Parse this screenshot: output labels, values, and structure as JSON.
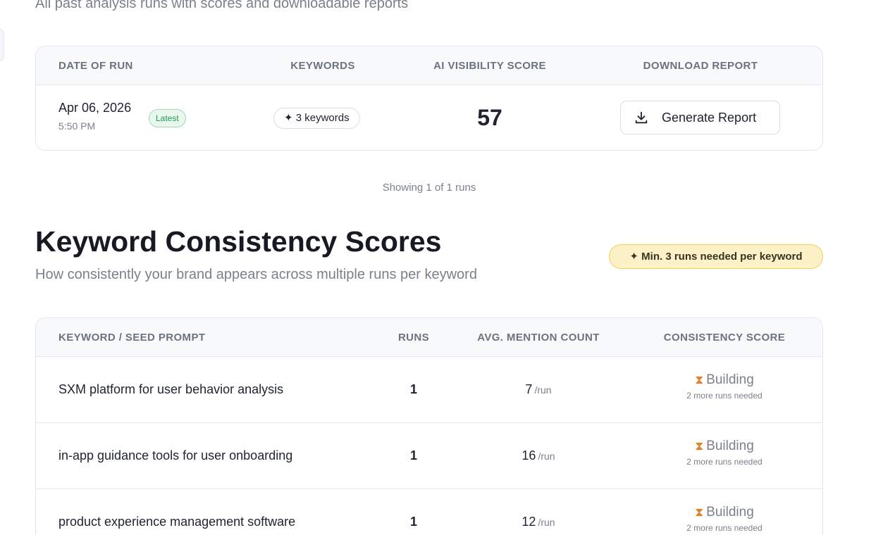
{
  "runs_section": {
    "subtitle": "All past analysis runs with scores and downloadable reports",
    "columns": {
      "date": "DATE OF RUN",
      "keywords": "KEYWORDS",
      "score": "AI VISIBILITY SCORE",
      "download": "DOWNLOAD REPORT"
    },
    "rows": [
      {
        "date": "Apr 06, 2026",
        "time": "5:50 PM",
        "badge": "Latest",
        "keywords": "✦ 3 keywords",
        "score": "57",
        "button_label": "Generate Report"
      }
    ],
    "footer": "Showing 1 of 1 runs"
  },
  "consistency_section": {
    "title": "Keyword Consistency Scores",
    "subtitle": "How consistently your brand appears across multiple runs per keyword",
    "badge": "✦ Min. 3 runs needed per keyword",
    "columns": {
      "keyword": "KEYWORD / SEED PROMPT",
      "runs": "RUNS",
      "avg": "AVG. MENTION COUNT",
      "consistency": "CONSISTENCY SCORE"
    },
    "unit": "/run",
    "rows": [
      {
        "keyword": "SXM platform for user behavior analysis",
        "runs": "1",
        "avg": "7",
        "status": "Building",
        "hint": "2 more runs needed"
      },
      {
        "keyword": "in-app guidance tools for user onboarding",
        "runs": "1",
        "avg": "16",
        "status": "Building",
        "hint": "2 more runs needed"
      },
      {
        "keyword": "product experience management software",
        "runs": "1",
        "avg": "12",
        "status": "Building",
        "hint": "2 more runs needed"
      }
    ]
  },
  "icons": {
    "download": "download-icon",
    "sparkle": "sparkle-icon",
    "hourglass": "hourglass-icon"
  },
  "colors": {
    "latest_badge_bg": "#e9f8ee",
    "latest_badge_text": "#1f9a51",
    "min_badge_bg": "#fdf1c7",
    "min_badge_border": "#f2cf58",
    "hourglass": "#e0822a"
  }
}
